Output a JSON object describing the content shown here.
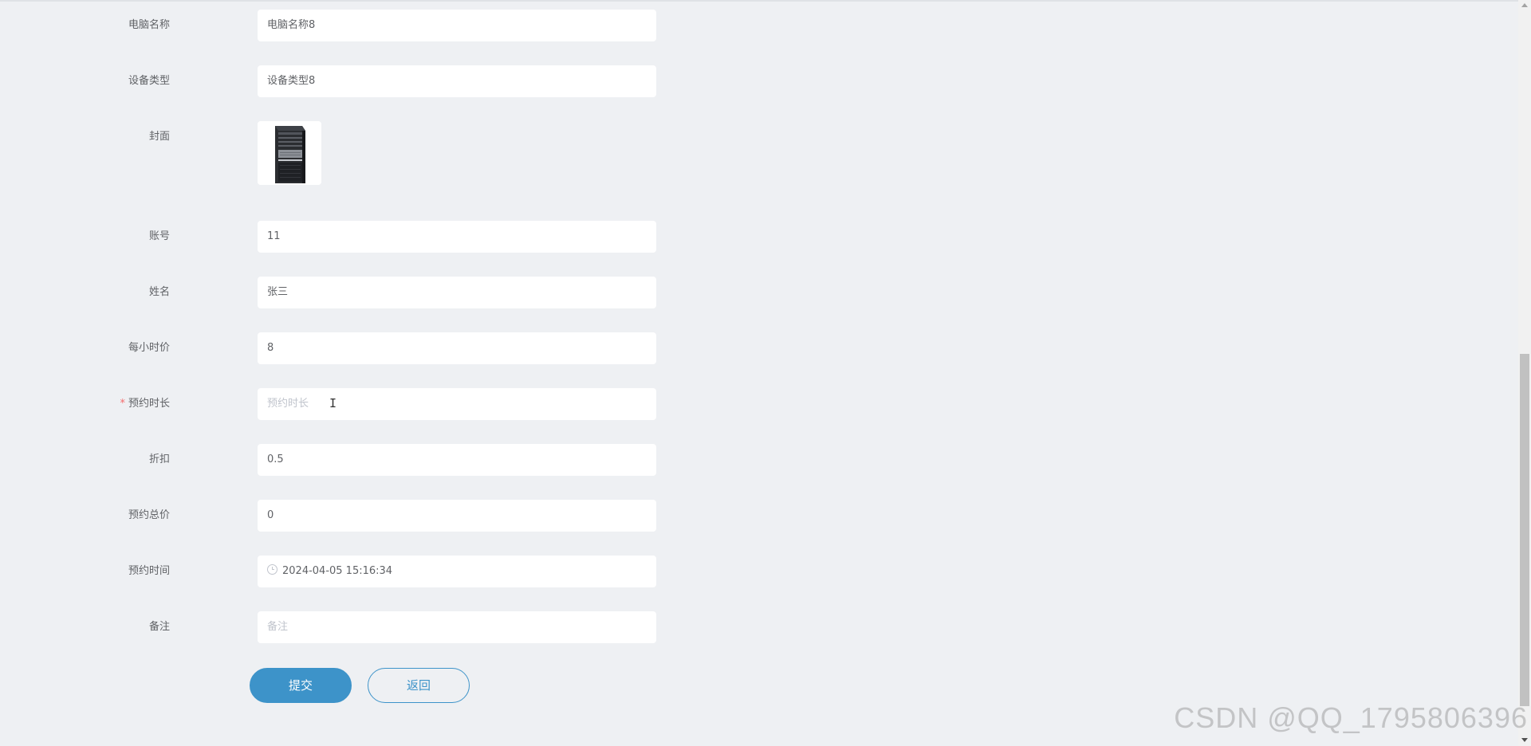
{
  "form": {
    "computer_name": {
      "label": "电脑名称",
      "value": "电脑名称8"
    },
    "device_type": {
      "label": "设备类型",
      "value": "设备类型8"
    },
    "cover": {
      "label": "封面",
      "image": "tower-pc-image"
    },
    "account": {
      "label": "账号",
      "value": "11"
    },
    "name": {
      "label": "姓名",
      "value": "张三"
    },
    "hourly_price": {
      "label": "每小时价",
      "value": "8"
    },
    "booking_duration": {
      "label": "预约时长",
      "required_mark": "*",
      "value": "",
      "placeholder": "预约时长"
    },
    "discount": {
      "label": "折扣",
      "value": "0.5"
    },
    "total_price": {
      "label": "预约总价",
      "value": "0"
    },
    "booking_time": {
      "label": "预约时间",
      "value": "2024-04-05 15:16:34",
      "icon": "clock-icon"
    },
    "remark": {
      "label": "备注",
      "value": "",
      "placeholder": "备注"
    }
  },
  "buttons": {
    "submit": "提交",
    "back": "返回"
  },
  "watermark": "CSDN @QQ_1795806396",
  "colors": {
    "background": "#eef0f3",
    "primary": "#3d93c9",
    "required": "#f56c6c",
    "label": "#606266",
    "placeholder": "#c0c4cc"
  }
}
